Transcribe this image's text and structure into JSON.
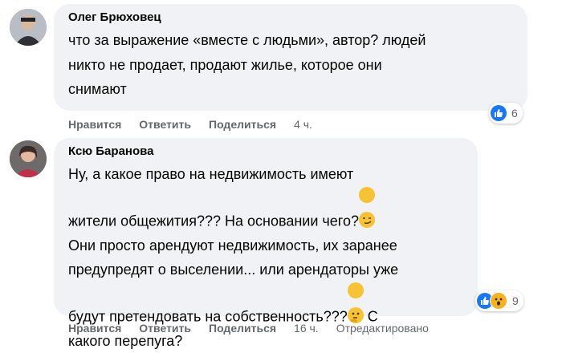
{
  "comments": [
    {
      "author": "Олег Брюховец",
      "text": "что за выражение «вместе с людьми», автор? людей\nникто не продает, продают жилье, которое они\nснимают",
      "actions": {
        "like": "Нравится",
        "reply": "Ответить",
        "share": "Поделиться",
        "time": "4 ч."
      },
      "reactions": {
        "icons": [
          "like-icon"
        ],
        "count": "6"
      }
    },
    {
      "author": "Ксю Баранова",
      "text_lines": [
        "Ну, а какое право на недвижимость имеют",
        "жители общежития??? На основании чего?",
        "Они просто арендуют недвижимость, их заранее",
        "предупредят о выселении... или арендаторы уже",
        "будут претендовать на собственность???",
        " С",
        "какого перепуга?"
      ],
      "emojis": [
        "smirk-emoji",
        "thinking-emoji"
      ],
      "actions": {
        "like": "Нравится",
        "reply": "Ответить",
        "share": "Поделиться",
        "time": "16 ч.",
        "edited": "Отредактировано"
      },
      "reactions": {
        "icons": [
          "like-icon",
          "wow-icon"
        ],
        "count": "9"
      }
    }
  ],
  "colors": {
    "bubble": "#f0f2f5",
    "secondary_text": "#65676b",
    "like_blue": "#1877f2",
    "emoji_yellow": "#f7c233"
  }
}
